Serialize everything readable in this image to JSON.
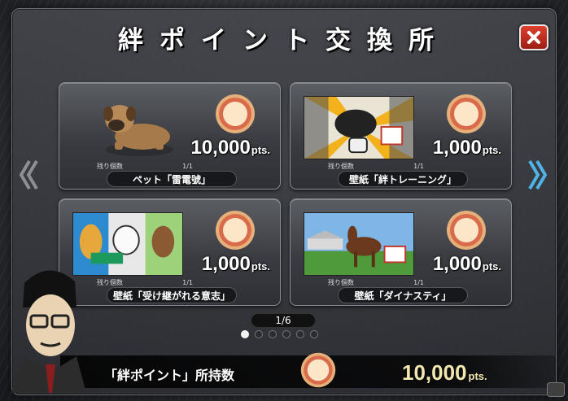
{
  "title": "絆ポイント交換所",
  "colors": {
    "accent_gold": "#f3e9b0",
    "close_red": "#c7301f",
    "nav_arrow_blue": "#4fb3e8"
  },
  "items": [
    {
      "name": "ペット「雷電號」",
      "price": "10,000",
      "unit": "pts.",
      "stock_label": "残り個数",
      "stock": "1/1"
    },
    {
      "name": "壁紙「絆トレーニング」",
      "price": "1,000",
      "unit": "pts.",
      "stock_label": "残り個数",
      "stock": "1/1"
    },
    {
      "name": "壁紙「受け継がれる意志」",
      "price": "1,000",
      "unit": "pts.",
      "stock_label": "残り個数",
      "stock": "1/1"
    },
    {
      "name": "壁紙「ダイナスティ」",
      "price": "1,000",
      "unit": "pts.",
      "stock_label": "残り個数",
      "stock": "1/1"
    }
  ],
  "badge_text": "絆",
  "pager": {
    "label": "1/6",
    "current_page": 1,
    "total_pages": 6
  },
  "footer": {
    "label": "「絆ポイント」所持数",
    "value": "10,000",
    "unit": "pts."
  },
  "icons": {
    "close": "close-x-icon",
    "prev": "chevron-left-icon",
    "next": "chevron-right-icon"
  }
}
